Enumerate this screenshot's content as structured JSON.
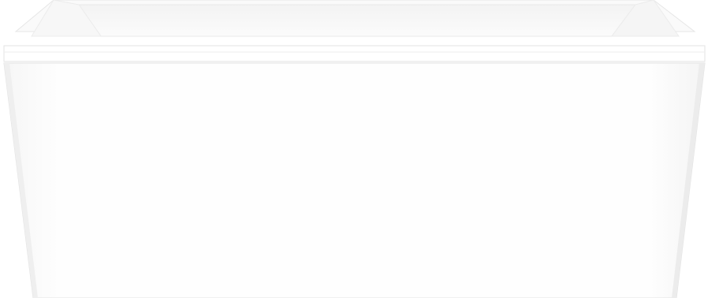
{
  "image": {
    "subject": "freestanding-rectangular-bathtub",
    "background_color": "#ffffff",
    "tub_color": "#fdfdfd",
    "shadow_color": "#e4e4e4"
  }
}
